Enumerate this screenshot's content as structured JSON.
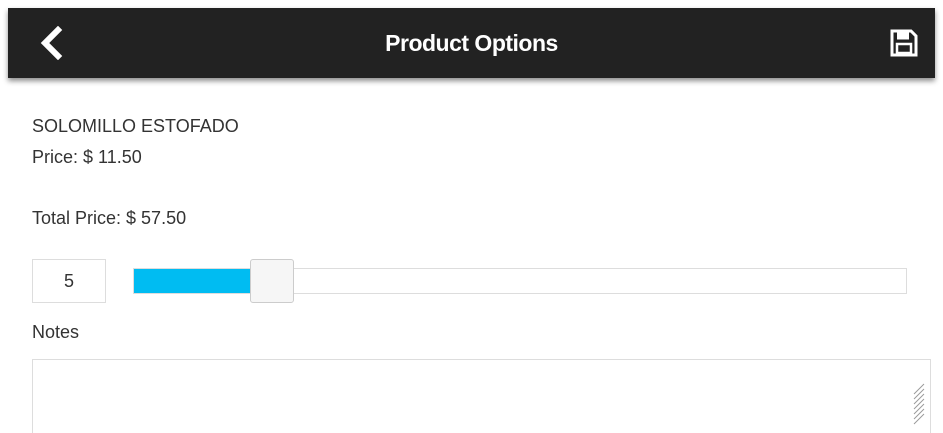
{
  "header": {
    "title": "Product Options",
    "back_icon": "chevron-left-icon",
    "save_icon": "floppy-disk-icon",
    "background": "#222222",
    "text_color": "#ffffff"
  },
  "product": {
    "name": "SOLOMILLO ESTOFADO",
    "price_text": "Price: $ 11.50",
    "total_text": "Total Price: $ 57.50"
  },
  "quantity": {
    "value": "5",
    "slider_fraction": 0.16,
    "fill_color": "#00bcf2"
  },
  "notes": {
    "label": "Notes",
    "value": "",
    "placeholder": ""
  }
}
